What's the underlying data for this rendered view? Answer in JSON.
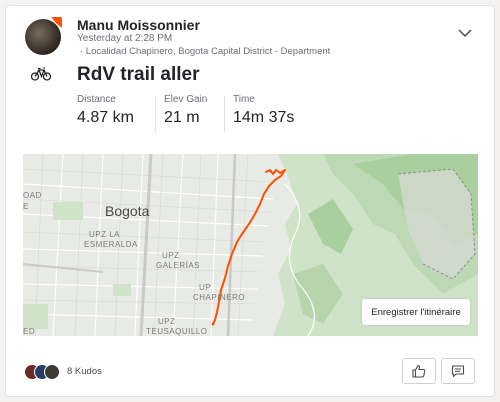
{
  "athlete": {
    "name": "Manu Moissonnier",
    "timestamp": "Yesterday at 2:28 PM",
    "location": "· Localidad Chapinero, Bogota Capital District - Department"
  },
  "activity": {
    "type_icon": "bike-icon",
    "title": "RdV trail aller",
    "stats": [
      {
        "label": "Distance",
        "value": "4.87 km"
      },
      {
        "label": "Elev Gain",
        "value": "21 m"
      },
      {
        "label": "Time",
        "value": "14m 37s"
      }
    ]
  },
  "map": {
    "city_label": "Bogota",
    "labels": [
      "OAD",
      "E",
      "UPZ LA",
      "ESMERALDA",
      "UPZ",
      "GALERÍAS",
      "UP",
      "CHAPINERO",
      "UPZ",
      "TEUSAQUILLO",
      "ED"
    ],
    "route_color": "#fc5200",
    "route_button": "Enregistrer l'itinéraire"
  },
  "footer": {
    "kudos_text": "8 Kudos",
    "like_icon": "thumbs-up-icon",
    "comment_icon": "comment-icon"
  },
  "colors": {
    "accent": "#fc5200",
    "text": "#242428",
    "muted": "#6d6d78"
  }
}
